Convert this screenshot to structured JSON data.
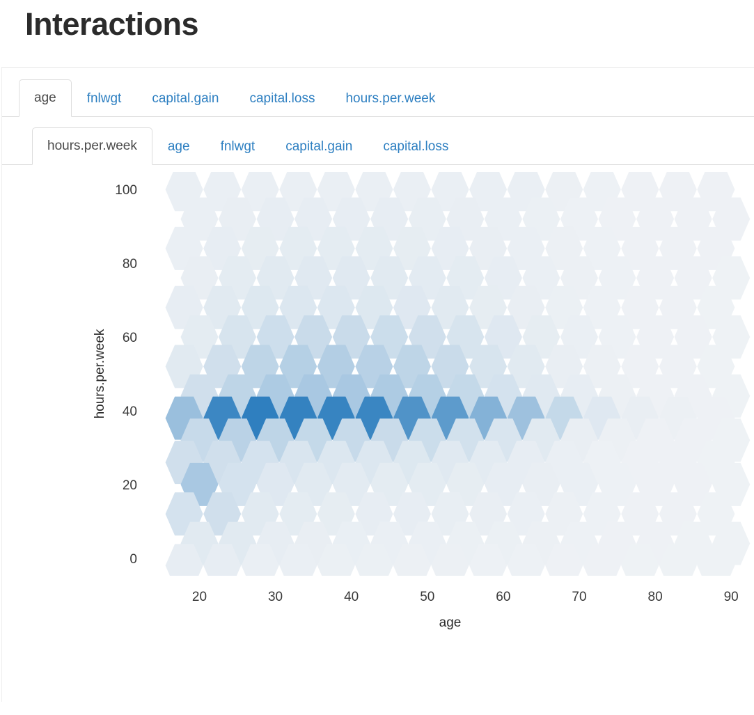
{
  "header": {
    "title": "Interactions"
  },
  "outer_tabs": {
    "active_index": 0,
    "items": [
      {
        "label": "age"
      },
      {
        "label": "fnlwgt"
      },
      {
        "label": "capital.gain"
      },
      {
        "label": "capital.loss"
      },
      {
        "label": "hours.per.week"
      }
    ]
  },
  "inner_tabs": {
    "active_index": 0,
    "items": [
      {
        "label": "hours.per.week"
      },
      {
        "label": "age"
      },
      {
        "label": "fnlwgt"
      },
      {
        "label": "capital.gain"
      },
      {
        "label": "capital.loss"
      }
    ]
  },
  "colors": {
    "link": "#2d7fc1",
    "active_tab_text": "#4a4a4a",
    "title": "#2b2b2b",
    "border": "#dddddd",
    "hex_min": "#f0f2f4",
    "hex_max": "#2f7fbf",
    "plot_background": "#ffffff"
  },
  "chart_data": {
    "type": "heatmap",
    "subtype": "hexbin",
    "title": "",
    "xlabel": "age",
    "ylabel": "hours.per.week",
    "xlim": [
      14,
      92
    ],
    "ylim": [
      -4,
      104
    ],
    "xticks": [
      20,
      30,
      40,
      50,
      60,
      70,
      80,
      90
    ],
    "yticks": [
      0,
      20,
      40,
      60,
      80,
      100
    ],
    "grid": false,
    "legend": false,
    "colorscale": {
      "low": "#f2f4f6",
      "high": "#2f7fbf",
      "metric": "count"
    },
    "hex_radius_x": 27,
    "hex_radius_y": 31,
    "note": "Hexagonal binning of age vs hours.per.week; density given as relative count 0-1 per bin.",
    "bins": [
      {
        "x": 18,
        "y": 100,
        "v": 0.02
      },
      {
        "x": 23,
        "y": 100,
        "v": 0.02
      },
      {
        "x": 28,
        "y": 100,
        "v": 0.02
      },
      {
        "x": 33,
        "y": 100,
        "v": 0.02
      },
      {
        "x": 38,
        "y": 100,
        "v": 0.02
      },
      {
        "x": 43,
        "y": 100,
        "v": 0.02
      },
      {
        "x": 48,
        "y": 100,
        "v": 0.02
      },
      {
        "x": 53,
        "y": 100,
        "v": 0.02
      },
      {
        "x": 58,
        "y": 100,
        "v": 0.02
      },
      {
        "x": 63,
        "y": 100,
        "v": 0.02
      },
      {
        "x": 68,
        "y": 100,
        "v": 0.015
      },
      {
        "x": 73,
        "y": 100,
        "v": 0.012
      },
      {
        "x": 78,
        "y": 100,
        "v": 0.01
      },
      {
        "x": 83,
        "y": 100,
        "v": 0.01
      },
      {
        "x": 88,
        "y": 100,
        "v": 0.01
      },
      {
        "x": 20,
        "y": 92,
        "v": 0.02
      },
      {
        "x": 25,
        "y": 92,
        "v": 0.025
      },
      {
        "x": 30,
        "y": 92,
        "v": 0.03
      },
      {
        "x": 35,
        "y": 92,
        "v": 0.03
      },
      {
        "x": 40,
        "y": 92,
        "v": 0.03
      },
      {
        "x": 45,
        "y": 92,
        "v": 0.03
      },
      {
        "x": 50,
        "y": 92,
        "v": 0.028
      },
      {
        "x": 55,
        "y": 92,
        "v": 0.025
      },
      {
        "x": 60,
        "y": 92,
        "v": 0.02
      },
      {
        "x": 65,
        "y": 92,
        "v": 0.018
      },
      {
        "x": 70,
        "y": 92,
        "v": 0.012
      },
      {
        "x": 75,
        "y": 92,
        "v": 0.01
      },
      {
        "x": 80,
        "y": 92,
        "v": 0.01
      },
      {
        "x": 85,
        "y": 92,
        "v": 0.01
      },
      {
        "x": 90,
        "y": 92,
        "v": 0.01
      },
      {
        "x": 18,
        "y": 84,
        "v": 0.02
      },
      {
        "x": 23,
        "y": 84,
        "v": 0.03
      },
      {
        "x": 28,
        "y": 84,
        "v": 0.035
      },
      {
        "x": 33,
        "y": 84,
        "v": 0.04
      },
      {
        "x": 38,
        "y": 84,
        "v": 0.04
      },
      {
        "x": 43,
        "y": 84,
        "v": 0.04
      },
      {
        "x": 48,
        "y": 84,
        "v": 0.035
      },
      {
        "x": 53,
        "y": 84,
        "v": 0.03
      },
      {
        "x": 58,
        "y": 84,
        "v": 0.025
      },
      {
        "x": 63,
        "y": 84,
        "v": 0.02
      },
      {
        "x": 68,
        "y": 84,
        "v": 0.015
      },
      {
        "x": 73,
        "y": 84,
        "v": 0.012
      },
      {
        "x": 78,
        "y": 84,
        "v": 0.01
      },
      {
        "x": 83,
        "y": 84,
        "v": 0.01
      },
      {
        "x": 88,
        "y": 84,
        "v": 0.01
      },
      {
        "x": 20,
        "y": 76,
        "v": 0.025
      },
      {
        "x": 25,
        "y": 76,
        "v": 0.04
      },
      {
        "x": 30,
        "y": 76,
        "v": 0.05
      },
      {
        "x": 35,
        "y": 76,
        "v": 0.055
      },
      {
        "x": 40,
        "y": 76,
        "v": 0.055
      },
      {
        "x": 45,
        "y": 76,
        "v": 0.05
      },
      {
        "x": 50,
        "y": 76,
        "v": 0.045
      },
      {
        "x": 55,
        "y": 76,
        "v": 0.04
      },
      {
        "x": 60,
        "y": 76,
        "v": 0.03
      },
      {
        "x": 65,
        "y": 76,
        "v": 0.02
      },
      {
        "x": 70,
        "y": 76,
        "v": 0.015
      },
      {
        "x": 75,
        "y": 76,
        "v": 0.012
      },
      {
        "x": 80,
        "y": 76,
        "v": 0.01
      },
      {
        "x": 85,
        "y": 76,
        "v": 0.01
      },
      {
        "x": 90,
        "y": 76,
        "v": 0.008
      },
      {
        "x": 18,
        "y": 68,
        "v": 0.03
      },
      {
        "x": 23,
        "y": 68,
        "v": 0.05
      },
      {
        "x": 28,
        "y": 68,
        "v": 0.065
      },
      {
        "x": 33,
        "y": 68,
        "v": 0.07
      },
      {
        "x": 38,
        "y": 68,
        "v": 0.07
      },
      {
        "x": 43,
        "y": 68,
        "v": 0.065
      },
      {
        "x": 48,
        "y": 68,
        "v": 0.06
      },
      {
        "x": 53,
        "y": 68,
        "v": 0.05
      },
      {
        "x": 58,
        "y": 68,
        "v": 0.035
      },
      {
        "x": 63,
        "y": 68,
        "v": 0.025
      },
      {
        "x": 68,
        "y": 68,
        "v": 0.018
      },
      {
        "x": 73,
        "y": 68,
        "v": 0.012
      },
      {
        "x": 78,
        "y": 68,
        "v": 0.01
      },
      {
        "x": 83,
        "y": 68,
        "v": 0.01
      },
      {
        "x": 88,
        "y": 68,
        "v": 0.008
      },
      {
        "x": 20,
        "y": 60,
        "v": 0.04
      },
      {
        "x": 25,
        "y": 60,
        "v": 0.09
      },
      {
        "x": 30,
        "y": 60,
        "v": 0.13
      },
      {
        "x": 35,
        "y": 60,
        "v": 0.15
      },
      {
        "x": 40,
        "y": 60,
        "v": 0.15
      },
      {
        "x": 45,
        "y": 60,
        "v": 0.14
      },
      {
        "x": 50,
        "y": 60,
        "v": 0.12
      },
      {
        "x": 55,
        "y": 60,
        "v": 0.09
      },
      {
        "x": 60,
        "y": 60,
        "v": 0.06
      },
      {
        "x": 65,
        "y": 60,
        "v": 0.035
      },
      {
        "x": 70,
        "y": 60,
        "v": 0.02
      },
      {
        "x": 75,
        "y": 60,
        "v": 0.012
      },
      {
        "x": 80,
        "y": 60,
        "v": 0.01
      },
      {
        "x": 85,
        "y": 60,
        "v": 0.01
      },
      {
        "x": 90,
        "y": 60,
        "v": 0.008
      },
      {
        "x": 18,
        "y": 52,
        "v": 0.05
      },
      {
        "x": 23,
        "y": 52,
        "v": 0.12
      },
      {
        "x": 28,
        "y": 52,
        "v": 0.2
      },
      {
        "x": 33,
        "y": 52,
        "v": 0.24
      },
      {
        "x": 38,
        "y": 52,
        "v": 0.25
      },
      {
        "x": 43,
        "y": 52,
        "v": 0.23
      },
      {
        "x": 48,
        "y": 52,
        "v": 0.2
      },
      {
        "x": 53,
        "y": 52,
        "v": 0.15
      },
      {
        "x": 58,
        "y": 52,
        "v": 0.09
      },
      {
        "x": 63,
        "y": 52,
        "v": 0.05
      },
      {
        "x": 68,
        "y": 52,
        "v": 0.025
      },
      {
        "x": 73,
        "y": 52,
        "v": 0.015
      },
      {
        "x": 78,
        "y": 52,
        "v": 0.01
      },
      {
        "x": 83,
        "y": 52,
        "v": 0.01
      },
      {
        "x": 88,
        "y": 52,
        "v": 0.008
      },
      {
        "x": 20,
        "y": 44,
        "v": 0.12
      },
      {
        "x": 25,
        "y": 44,
        "v": 0.2
      },
      {
        "x": 30,
        "y": 44,
        "v": 0.28
      },
      {
        "x": 35,
        "y": 44,
        "v": 0.3
      },
      {
        "x": 40,
        "y": 44,
        "v": 0.3
      },
      {
        "x": 45,
        "y": 44,
        "v": 0.28
      },
      {
        "x": 50,
        "y": 44,
        "v": 0.24
      },
      {
        "x": 55,
        "y": 44,
        "v": 0.17
      },
      {
        "x": 60,
        "y": 44,
        "v": 0.1
      },
      {
        "x": 65,
        "y": 44,
        "v": 0.055
      },
      {
        "x": 70,
        "y": 44,
        "v": 0.03
      },
      {
        "x": 75,
        "y": 44,
        "v": 0.015
      },
      {
        "x": 80,
        "y": 44,
        "v": 0.01
      },
      {
        "x": 85,
        "y": 44,
        "v": 0.01
      },
      {
        "x": 90,
        "y": 44,
        "v": 0.008
      },
      {
        "x": 18,
        "y": 38,
        "v": 0.38
      },
      {
        "x": 23,
        "y": 38,
        "v": 0.92
      },
      {
        "x": 28,
        "y": 38,
        "v": 1.0
      },
      {
        "x": 33,
        "y": 38,
        "v": 0.97
      },
      {
        "x": 38,
        "y": 38,
        "v": 0.95
      },
      {
        "x": 43,
        "y": 38,
        "v": 0.93
      },
      {
        "x": 48,
        "y": 38,
        "v": 0.8
      },
      {
        "x": 53,
        "y": 38,
        "v": 0.72
      },
      {
        "x": 58,
        "y": 38,
        "v": 0.5
      },
      {
        "x": 63,
        "y": 38,
        "v": 0.36
      },
      {
        "x": 68,
        "y": 38,
        "v": 0.17
      },
      {
        "x": 73,
        "y": 38,
        "v": 0.06
      },
      {
        "x": 78,
        "y": 38,
        "v": 0.025
      },
      {
        "x": 83,
        "y": 38,
        "v": 0.015
      },
      {
        "x": 88,
        "y": 38,
        "v": 0.01
      },
      {
        "x": 20,
        "y": 32,
        "v": 0.16
      },
      {
        "x": 25,
        "y": 32,
        "v": 0.22
      },
      {
        "x": 30,
        "y": 32,
        "v": 0.2
      },
      {
        "x": 35,
        "y": 32,
        "v": 0.17
      },
      {
        "x": 40,
        "y": 32,
        "v": 0.16
      },
      {
        "x": 45,
        "y": 32,
        "v": 0.15
      },
      {
        "x": 50,
        "y": 32,
        "v": 0.14
      },
      {
        "x": 55,
        "y": 32,
        "v": 0.11
      },
      {
        "x": 60,
        "y": 32,
        "v": 0.08
      },
      {
        "x": 65,
        "y": 32,
        "v": 0.05
      },
      {
        "x": 70,
        "y": 32,
        "v": 0.025
      },
      {
        "x": 75,
        "y": 32,
        "v": 0.015
      },
      {
        "x": 80,
        "y": 32,
        "v": 0.01
      },
      {
        "x": 85,
        "y": 32,
        "v": 0.01
      },
      {
        "x": 90,
        "y": 32,
        "v": 0.008
      },
      {
        "x": 18,
        "y": 26,
        "v": 0.12
      },
      {
        "x": 23,
        "y": 26,
        "v": 0.12
      },
      {
        "x": 28,
        "y": 26,
        "v": 0.1
      },
      {
        "x": 33,
        "y": 26,
        "v": 0.08
      },
      {
        "x": 38,
        "y": 26,
        "v": 0.07
      },
      {
        "x": 43,
        "y": 26,
        "v": 0.07
      },
      {
        "x": 48,
        "y": 26,
        "v": 0.065
      },
      {
        "x": 53,
        "y": 26,
        "v": 0.055
      },
      {
        "x": 58,
        "y": 26,
        "v": 0.045
      },
      {
        "x": 63,
        "y": 26,
        "v": 0.03
      },
      {
        "x": 68,
        "y": 26,
        "v": 0.02
      },
      {
        "x": 73,
        "y": 26,
        "v": 0.012
      },
      {
        "x": 78,
        "y": 26,
        "v": 0.01
      },
      {
        "x": 83,
        "y": 26,
        "v": 0.01
      },
      {
        "x": 88,
        "y": 26,
        "v": 0.008
      },
      {
        "x": 20,
        "y": 20,
        "v": 0.3
      },
      {
        "x": 25,
        "y": 20,
        "v": 0.1
      },
      {
        "x": 30,
        "y": 20,
        "v": 0.06
      },
      {
        "x": 35,
        "y": 20,
        "v": 0.05
      },
      {
        "x": 40,
        "y": 20,
        "v": 0.045
      },
      {
        "x": 45,
        "y": 20,
        "v": 0.04
      },
      {
        "x": 50,
        "y": 20,
        "v": 0.04
      },
      {
        "x": 55,
        "y": 20,
        "v": 0.035
      },
      {
        "x": 60,
        "y": 20,
        "v": 0.03
      },
      {
        "x": 65,
        "y": 20,
        "v": 0.025
      },
      {
        "x": 70,
        "y": 20,
        "v": 0.02
      },
      {
        "x": 75,
        "y": 20,
        "v": 0.012
      },
      {
        "x": 80,
        "y": 20,
        "v": 0.01
      },
      {
        "x": 85,
        "y": 20,
        "v": 0.01
      },
      {
        "x": 90,
        "y": 20,
        "v": 0.008
      },
      {
        "x": 18,
        "y": 12,
        "v": 0.1
      },
      {
        "x": 23,
        "y": 12,
        "v": 0.12
      },
      {
        "x": 28,
        "y": 12,
        "v": 0.05
      },
      {
        "x": 33,
        "y": 12,
        "v": 0.04
      },
      {
        "x": 38,
        "y": 12,
        "v": 0.035
      },
      {
        "x": 43,
        "y": 12,
        "v": 0.03
      },
      {
        "x": 48,
        "y": 12,
        "v": 0.03
      },
      {
        "x": 53,
        "y": 12,
        "v": 0.028
      },
      {
        "x": 58,
        "y": 12,
        "v": 0.025
      },
      {
        "x": 63,
        "y": 12,
        "v": 0.02
      },
      {
        "x": 68,
        "y": 12,
        "v": 0.015
      },
      {
        "x": 73,
        "y": 12,
        "v": 0.012
      },
      {
        "x": 78,
        "y": 12,
        "v": 0.01
      },
      {
        "x": 83,
        "y": 12,
        "v": 0.01
      },
      {
        "x": 88,
        "y": 12,
        "v": 0.008
      },
      {
        "x": 20,
        "y": 4,
        "v": 0.05
      },
      {
        "x": 25,
        "y": 4,
        "v": 0.05
      },
      {
        "x": 30,
        "y": 4,
        "v": 0.03
      },
      {
        "x": 35,
        "y": 4,
        "v": 0.025
      },
      {
        "x": 40,
        "y": 4,
        "v": 0.022
      },
      {
        "x": 45,
        "y": 4,
        "v": 0.02
      },
      {
        "x": 50,
        "y": 4,
        "v": 0.02
      },
      {
        "x": 55,
        "y": 4,
        "v": 0.018
      },
      {
        "x": 60,
        "y": 4,
        "v": 0.018
      },
      {
        "x": 65,
        "y": 4,
        "v": 0.015
      },
      {
        "x": 70,
        "y": 4,
        "v": 0.012
      },
      {
        "x": 75,
        "y": 4,
        "v": 0.01
      },
      {
        "x": 80,
        "y": 4,
        "v": 0.01
      },
      {
        "x": 85,
        "y": 4,
        "v": 0.008
      },
      {
        "x": 90,
        "y": 4,
        "v": 0.008
      },
      {
        "x": 18,
        "y": -2,
        "v": 0.03
      },
      {
        "x": 23,
        "y": -2,
        "v": 0.03
      },
      {
        "x": 28,
        "y": -2,
        "v": 0.02
      },
      {
        "x": 33,
        "y": -2,
        "v": 0.02
      },
      {
        "x": 38,
        "y": -2,
        "v": 0.018
      },
      {
        "x": 43,
        "y": -2,
        "v": 0.018
      },
      {
        "x": 48,
        "y": -2,
        "v": 0.015
      },
      {
        "x": 53,
        "y": -2,
        "v": 0.015
      },
      {
        "x": 58,
        "y": -2,
        "v": 0.012
      },
      {
        "x": 63,
        "y": -2,
        "v": 0.012
      },
      {
        "x": 68,
        "y": -2,
        "v": 0.01
      },
      {
        "x": 73,
        "y": -2,
        "v": 0.01
      },
      {
        "x": 78,
        "y": -2,
        "v": 0.008
      },
      {
        "x": 83,
        "y": -2,
        "v": 0.008
      },
      {
        "x": 88,
        "y": -2,
        "v": 0.008
      }
    ]
  }
}
